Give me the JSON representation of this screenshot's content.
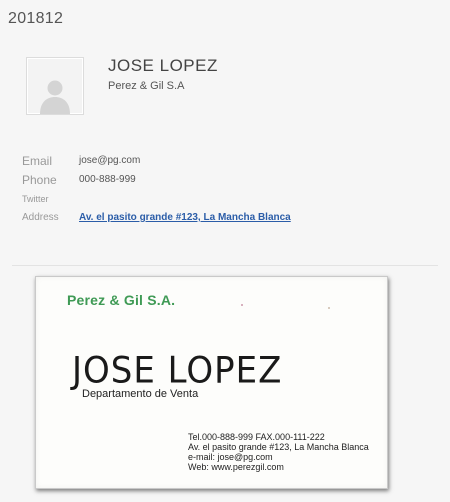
{
  "page": {
    "title": "201812"
  },
  "contact": {
    "name": "JOSE LOPEZ",
    "company": "Perez & Gil S.A"
  },
  "details": {
    "email_label": "Email",
    "email_value": "jose@pg.com",
    "phone_label": "Phone",
    "phone_value": "000-888-999",
    "twitter_label": "Twitter",
    "address_label": "Address",
    "address_value": "Av. el pasito grande #123, La Mancha Blanca"
  },
  "card": {
    "company": "Perez & Gil S.A.",
    "name": "JOSE LOPEZ",
    "department": "Departamento de Venta",
    "tel_fax": "Tel.000-888-999  FAX.000-111-222",
    "address": "Av. el pasito grande #123, La Mancha Blanca",
    "email": "e-mail: jose@pg.com",
    "web": "Web: www.perezgil.com"
  },
  "icons": {
    "avatar": "person-silhouette-icon"
  }
}
